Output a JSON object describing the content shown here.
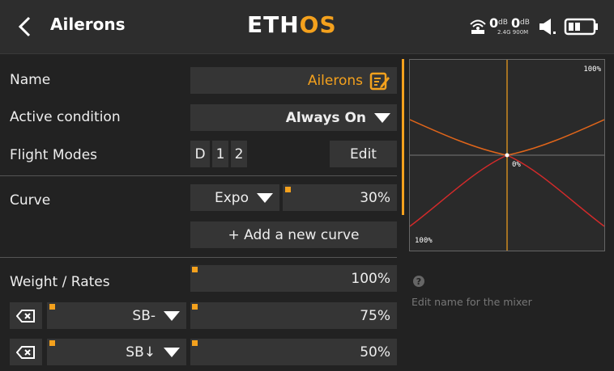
{
  "header": {
    "title": "Ailerons",
    "brand_prefix": "ETH",
    "brand_accent": "OS",
    "rssi_24": "0",
    "rssi_24_unit": "dB",
    "rssi_900": "0",
    "rssi_900_unit": "dB",
    "freq_label": "2.4G 900M",
    "icons": [
      "back-arrow-icon",
      "signal-antenna-icon",
      "speaker-icon",
      "battery-icon"
    ]
  },
  "form": {
    "name_label": "Name",
    "name_value": "Ailerons",
    "active_label": "Active condition",
    "active_value": "Always On",
    "modes_label": "Flight Modes",
    "modes": [
      "D",
      "1",
      "2"
    ],
    "modes_edit": "Edit",
    "curve_label": "Curve",
    "curve_type": "Expo",
    "curve_value": "30%",
    "add_curve": "+ Add a new curve",
    "weight_label": "Weight / Rates",
    "weight_value": "100%",
    "rate1_switch": "SB-",
    "rate1_value": "75%",
    "rate2_switch": "SB↓",
    "rate2_value": "50%"
  },
  "chart": {
    "top_label": "100%",
    "center_label": "0%",
    "bottom_label": "100%"
  },
  "help": {
    "text": "Edit name for the mixer"
  },
  "colors": {
    "accent": "#f4a11d",
    "curve_orange": "#e0651a",
    "curve_red": "#d42a2a",
    "background": "#222222",
    "field": "#353535"
  }
}
